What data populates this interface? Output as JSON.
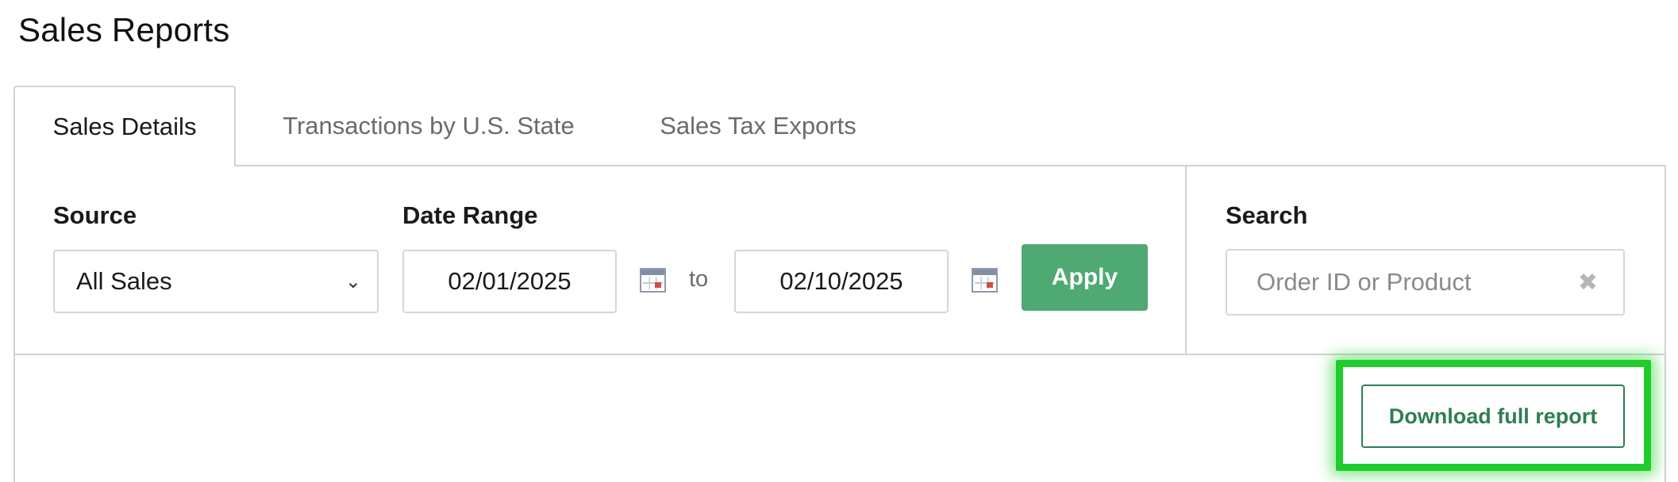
{
  "page": {
    "title": "Sales Reports"
  },
  "tabs": [
    {
      "label": "Sales Details",
      "active": true
    },
    {
      "label": "Transactions by U.S. State",
      "active": false
    },
    {
      "label": "Sales Tax Exports",
      "active": false
    }
  ],
  "filters": {
    "source": {
      "label": "Source",
      "value": "All Sales"
    },
    "date_range": {
      "label": "Date Range",
      "from": "02/01/2025",
      "to_text": "to",
      "to": "02/10/2025"
    },
    "apply_label": "Apply",
    "search": {
      "label": "Search",
      "placeholder": "Order ID or Product"
    }
  },
  "actions": {
    "download_label": "Download full report"
  },
  "colors": {
    "apply_bg": "#4ea973",
    "download_text": "#2f7e54",
    "highlight": "#1fcc2a"
  },
  "icons": {
    "calendar": "calendar-icon",
    "chevron": "chevron-down-icon",
    "clear": "close-icon"
  }
}
